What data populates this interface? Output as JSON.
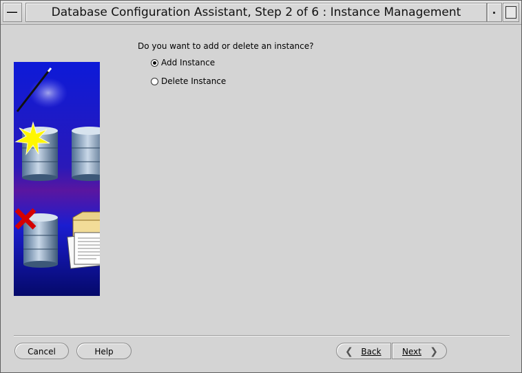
{
  "window": {
    "title": "Database Configuration Assistant, Step 2 of 6 : Instance Management"
  },
  "main": {
    "question": "Do you want to add or delete an instance?",
    "options": [
      {
        "label": "Add Instance",
        "selected": true
      },
      {
        "label": "Delete Instance",
        "selected": false
      }
    ]
  },
  "footer": {
    "cancel_label": "Cancel",
    "help_label": "Help",
    "back_label": "Back",
    "next_label": "Next"
  },
  "icons": [
    "window-menu-icon",
    "minimize-icon",
    "maximize-icon",
    "back-chevron-icon",
    "next-chevron-icon",
    "wizard-illustration"
  ]
}
